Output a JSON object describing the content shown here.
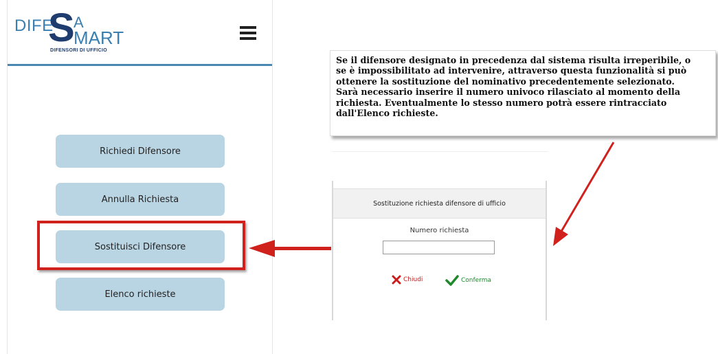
{
  "logo": {
    "dife": "DIFE",
    "s": "S",
    "a": "A",
    "mart": "MART",
    "subtitle": "DIFENSORI DI UFFICIO"
  },
  "header": {
    "menu_icon": "hamburger-menu-icon"
  },
  "menu": {
    "items": [
      {
        "label": "Richiedi Difensore"
      },
      {
        "label": "Annulla Richiesta"
      },
      {
        "label": "Sostituisci Difensore"
      },
      {
        "label": "Elenco richieste"
      }
    ]
  },
  "note": {
    "lines": [
      "Se il difensore designato in precedenza dal sistema risulta irreperibile, o",
      "se è impossibilitato ad intervenire, attraverso questa funzionalità si può",
      "ottenere la sostituzione del nominativo precedentemente selezionato.",
      "Sarà necessario inserire il numero univoco rilasciato al momento della",
      "richiesta. Eventualmente lo stesso numero potrà essere rintracciato",
      "dall'Elenco richieste."
    ]
  },
  "dialog": {
    "title": "Sostituzione richiesta difensore di ufficio",
    "field_label": "Numero richiesta",
    "field_value": "",
    "close_label": "Chiudi",
    "confirm_label": "Conferma"
  },
  "colors": {
    "accent_line": "#4a88b4",
    "button_bg": "#b9d4e3",
    "highlight": "#d0211c",
    "arrow": "#d0211c",
    "close": "#c81d1d",
    "confirm": "#1e8a2c"
  }
}
